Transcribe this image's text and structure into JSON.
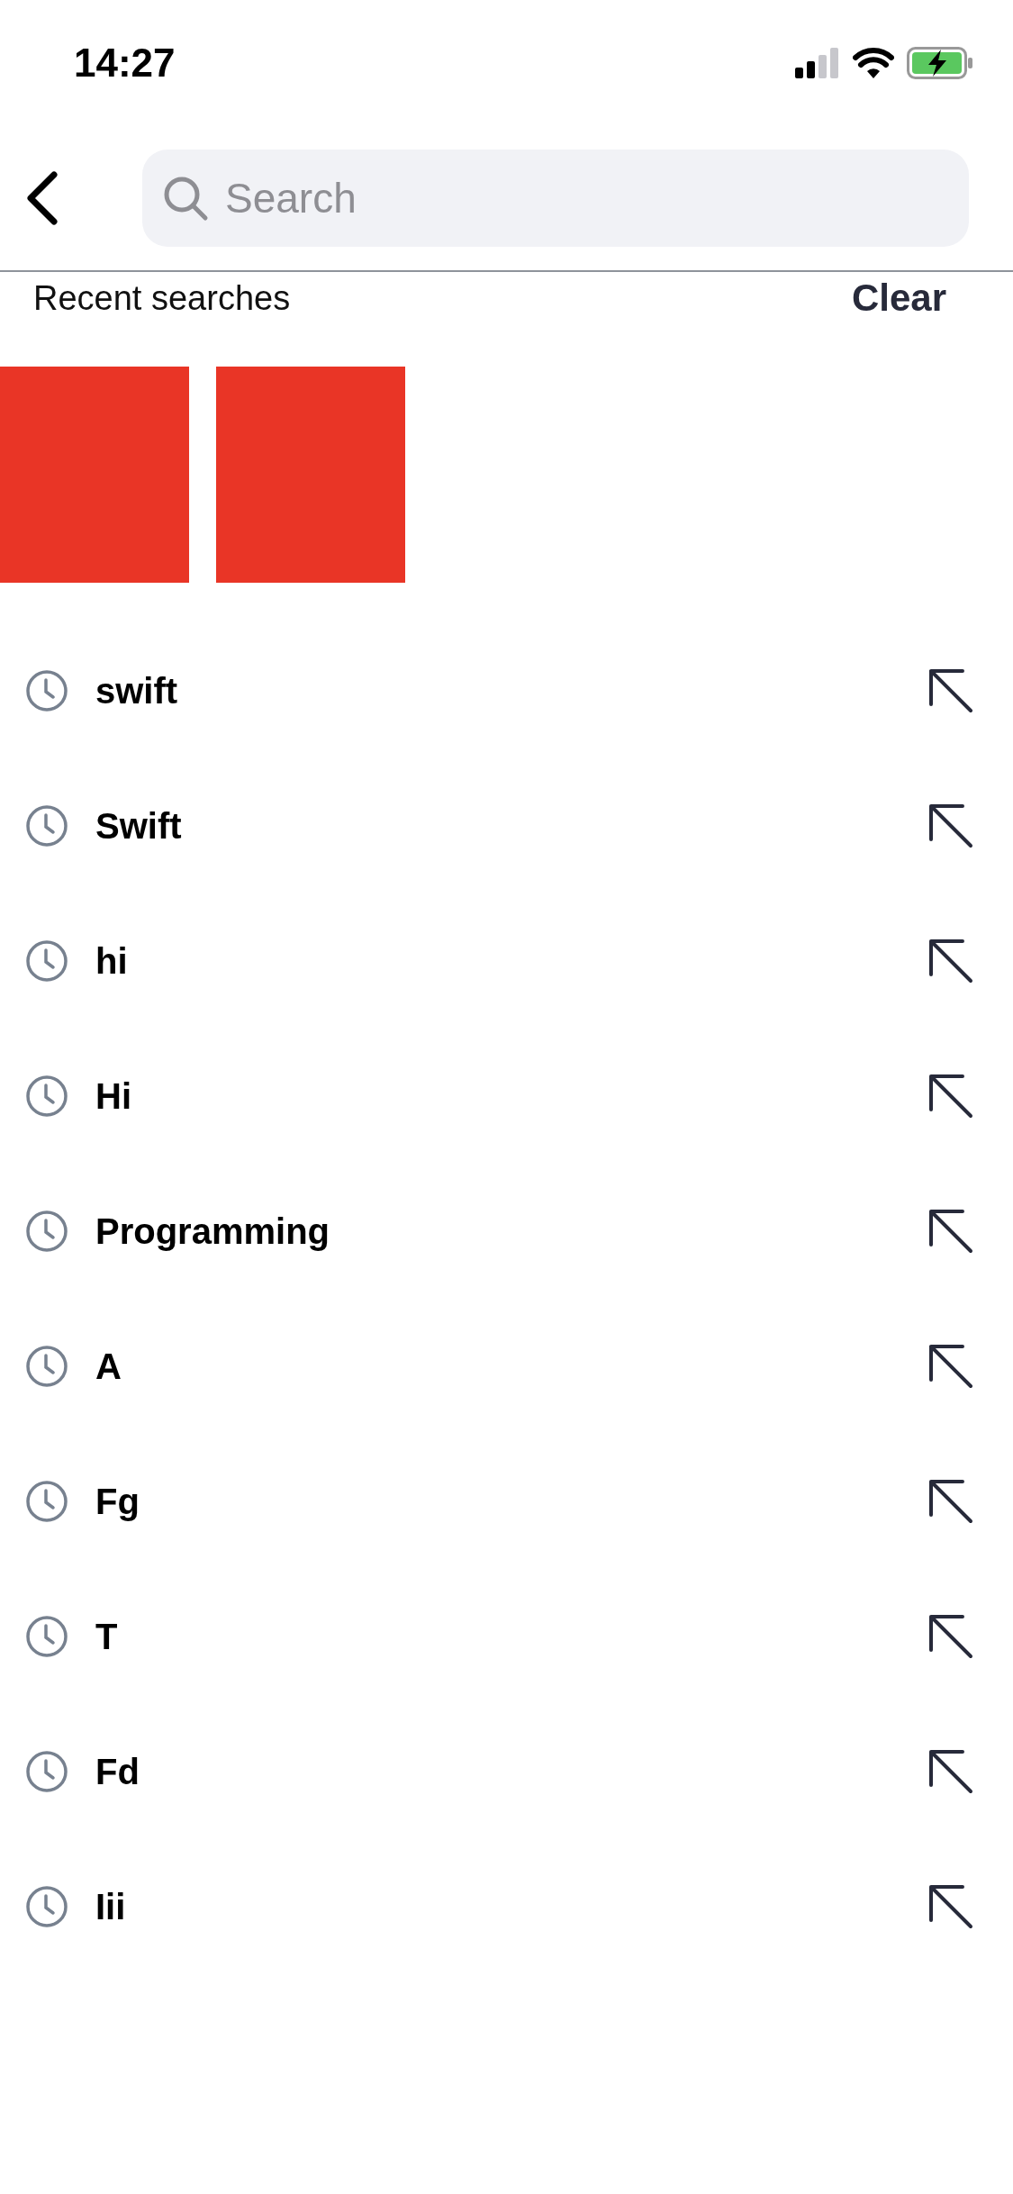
{
  "status_bar": {
    "time": "14:27"
  },
  "search": {
    "placeholder": "Search"
  },
  "recent": {
    "title": "Recent searches",
    "clear": "Clear"
  },
  "tiles": [
    {
      "kind": "block"
    },
    {
      "kind": "block"
    }
  ],
  "items": [
    {
      "label": "swift"
    },
    {
      "label": "Swift"
    },
    {
      "label": "hi"
    },
    {
      "label": "Hi"
    },
    {
      "label": "Programming"
    },
    {
      "label": "A"
    },
    {
      "label": "Fg"
    },
    {
      "label": "T"
    },
    {
      "label": "Fd"
    },
    {
      "label": "Iii"
    }
  ]
}
